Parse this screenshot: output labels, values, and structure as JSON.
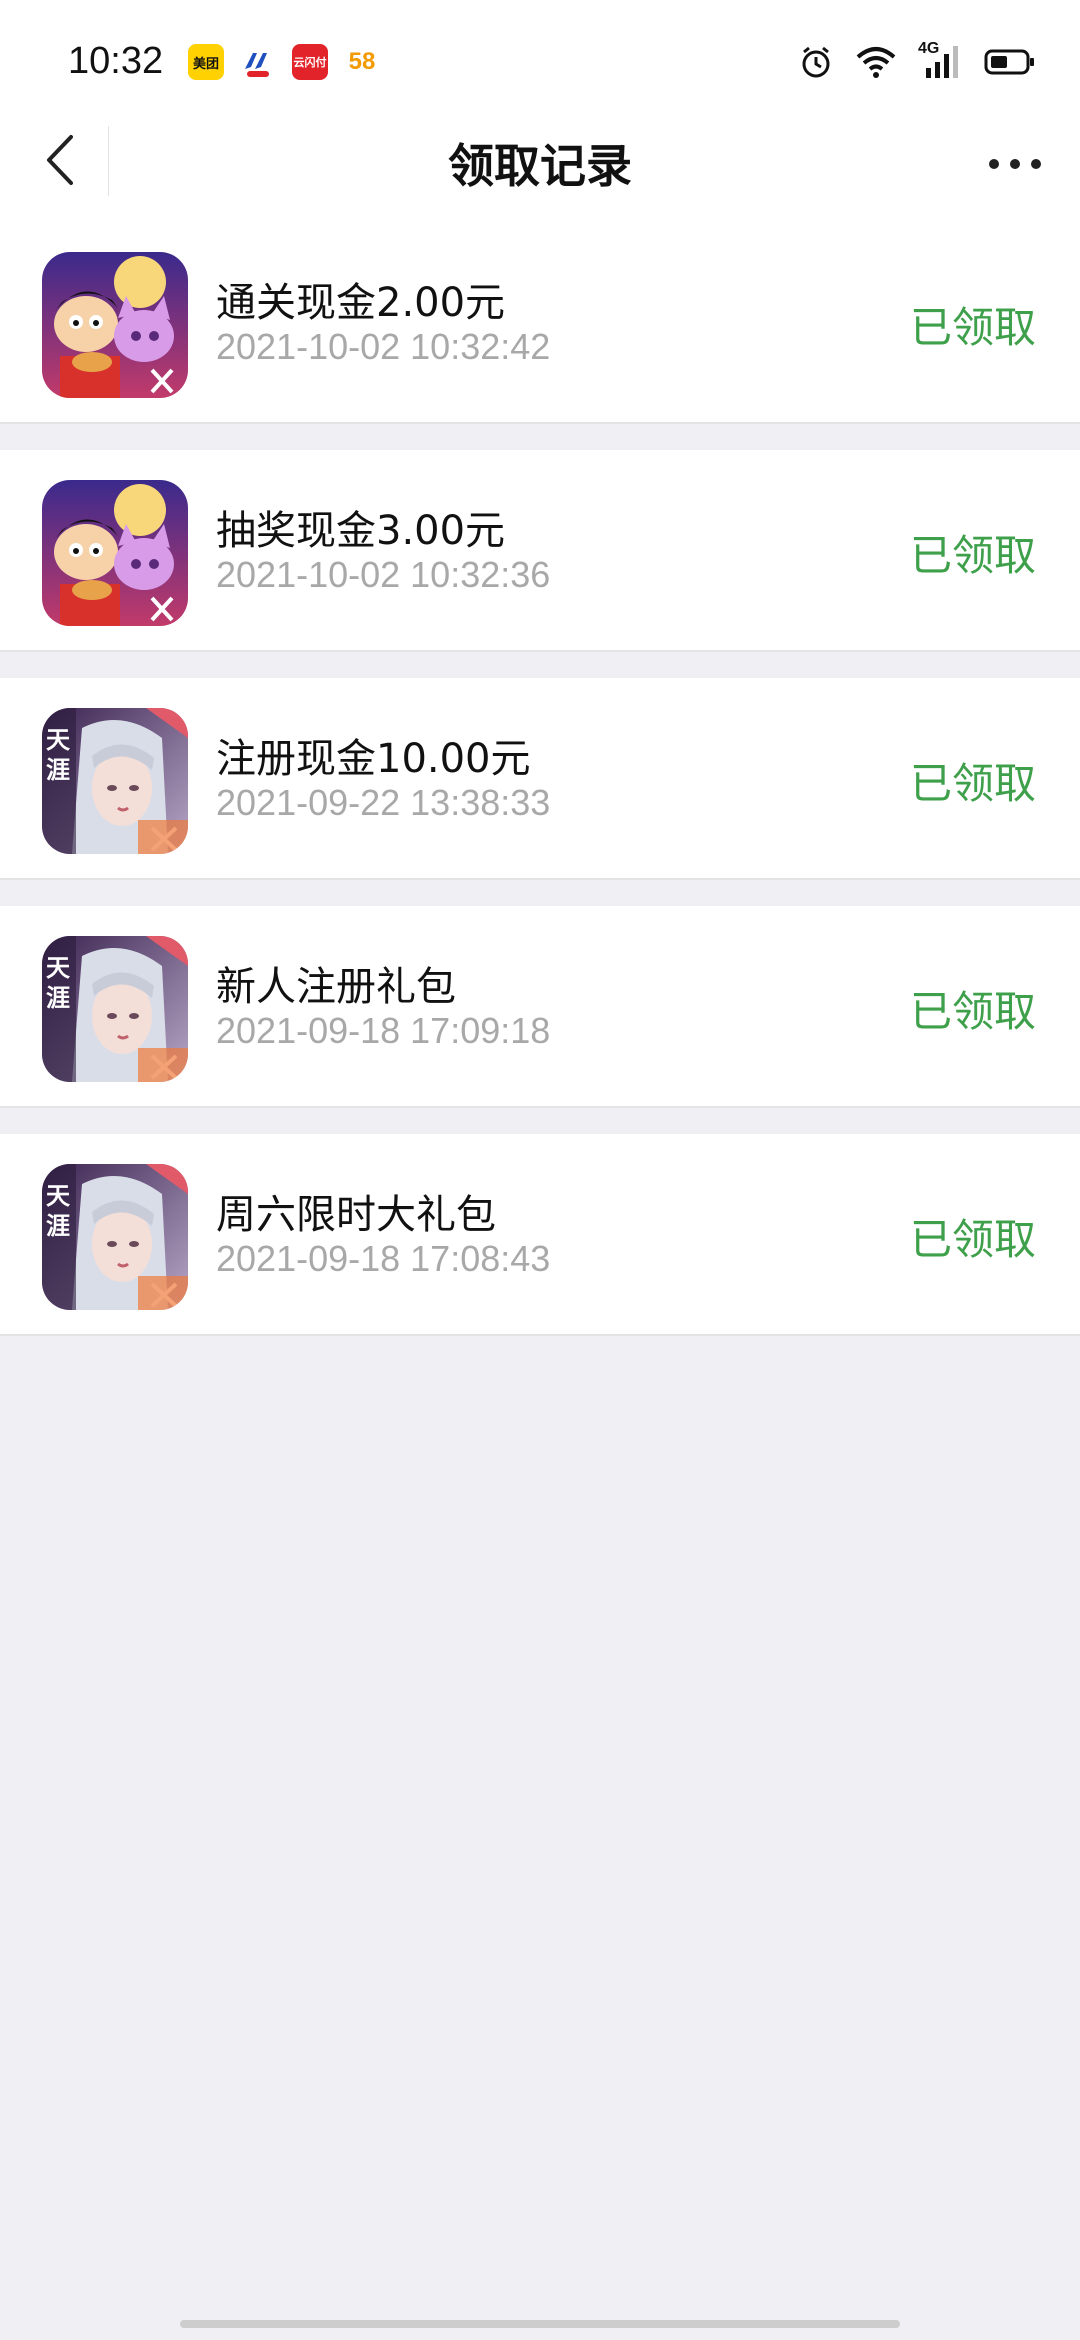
{
  "status_bar": {
    "time": "10:32",
    "app_icons": [
      {
        "name": "meituan-icon",
        "text": "美团",
        "bg": "#ffd100",
        "color": "#111"
      },
      {
        "name": "app2-icon",
        "text": "",
        "bg": "#1f4fbf",
        "color": "#fff"
      },
      {
        "name": "app3-icon",
        "text": "云闪付",
        "bg": "#e2232a",
        "color": "#fff"
      },
      {
        "name": "58-icon",
        "text": "58",
        "bg": "#ffffff",
        "color": "#f29a00"
      }
    ],
    "network": "4G"
  },
  "header": {
    "title": "领取记录"
  },
  "records": [
    {
      "name": "通关现金2.00元",
      "time": "2021-10-02 10:32:42",
      "status": "已领取",
      "game": "crayon-shin-chan"
    },
    {
      "name": "抽奖现金3.00元",
      "time": "2021-10-02 10:32:36",
      "status": "已领取",
      "game": "crayon-shin-chan"
    },
    {
      "name": "注册现金10.00元",
      "time": "2021-09-22 13:38:33",
      "status": "已领取",
      "game": "tianya"
    },
    {
      "name": "新人注册礼包",
      "time": "2021-09-18 17:09:18",
      "status": "已领取",
      "game": "tianya"
    },
    {
      "name": "周六限时大礼包",
      "time": "2021-09-18 17:08:43",
      "status": "已领取",
      "game": "tianya"
    }
  ],
  "colors": {
    "accent_green": "#3ea04a",
    "background": "#efeff4",
    "secondary_text": "#a8a8a8"
  }
}
